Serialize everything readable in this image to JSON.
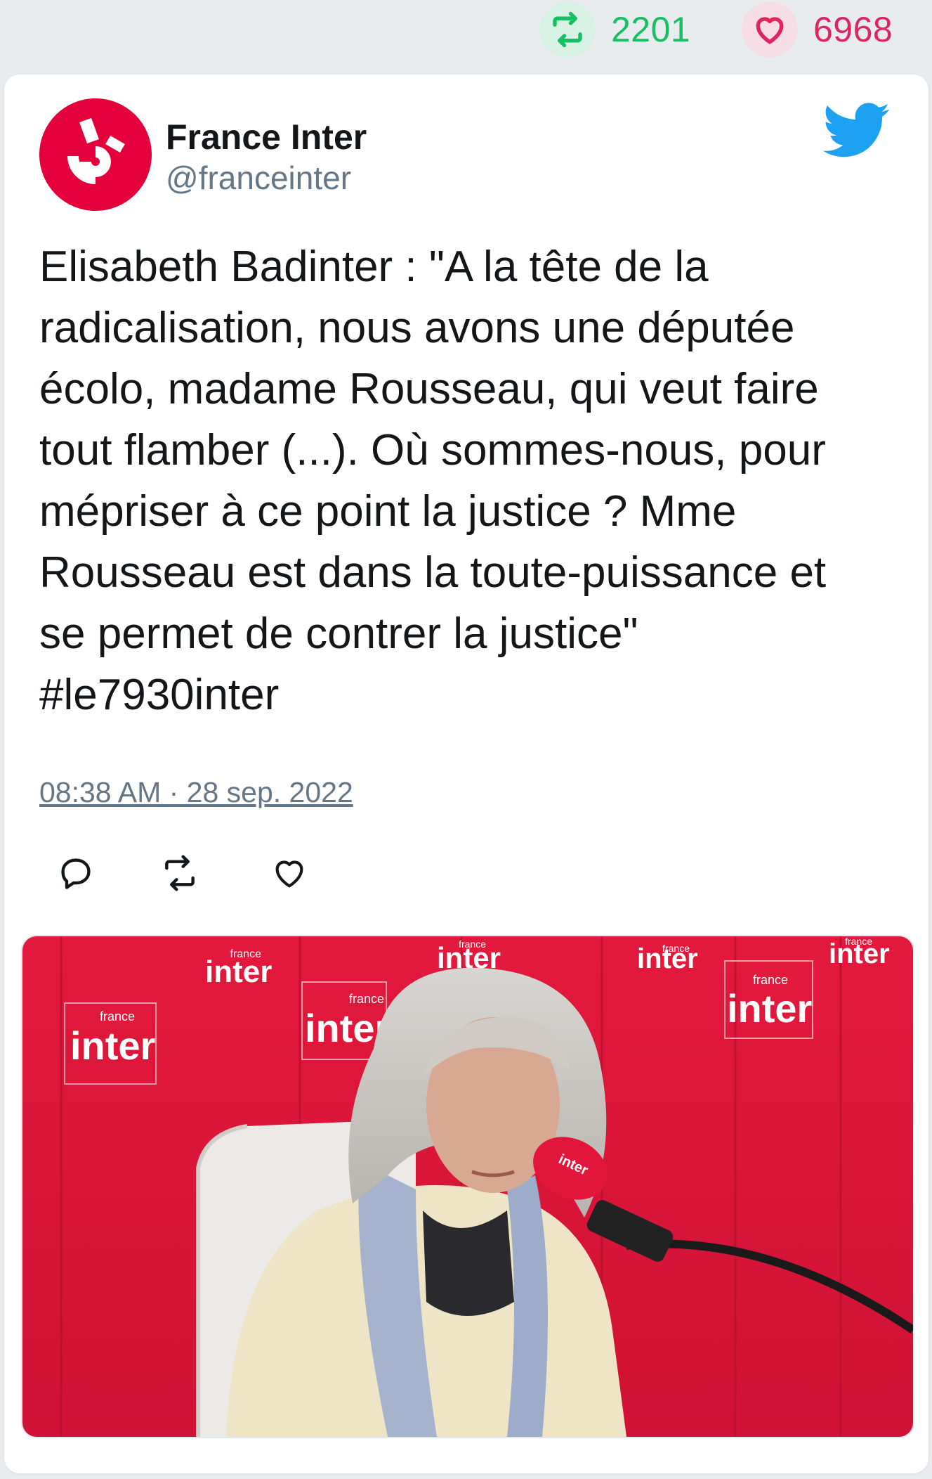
{
  "stats": {
    "retweets": "2201",
    "likes": "6968"
  },
  "tweet": {
    "author_name": "France Inter",
    "author_handle": "@franceinter",
    "text": "Elisabeth Badinter : \"A la tête de la\nradicalisation, nous avons une députée\nécolo, madame Rousseau, qui veut faire\ntout flamber (...). Où sommes-nous, pour\nmépriser à ce point la justice ? Mme\nRousseau est dans la toute-puissance et\nse permet de contrer la justice\"\n#le7930inter",
    "timestamp": "08:38 AM · 28 sep. 2022"
  },
  "media": {
    "backdrop_logos": [
      {
        "small": "france",
        "big": "inter"
      },
      {
        "small": "france",
        "big": "inter"
      },
      {
        "small": "france",
        "big": "inter"
      },
      {
        "small": "france",
        "big": "inter"
      },
      {
        "small": "france",
        "big": "inter"
      },
      {
        "small": "france",
        "big": "inter"
      },
      {
        "small": "france",
        "big": "inter"
      }
    ],
    "mic_label": "inter"
  },
  "icons": {
    "retweet": "retweet-icon",
    "like": "heart-icon",
    "reply": "reply-icon",
    "brand": "twitter-bird-icon",
    "avatar": "france-inter-logo"
  },
  "colors": {
    "retweet_green": "#17bf63",
    "like_red": "#e0245e",
    "twitter_blue": "#1da1f2",
    "brand_red": "#e4003a",
    "text_dark": "#14171a",
    "text_gray": "#657786"
  }
}
